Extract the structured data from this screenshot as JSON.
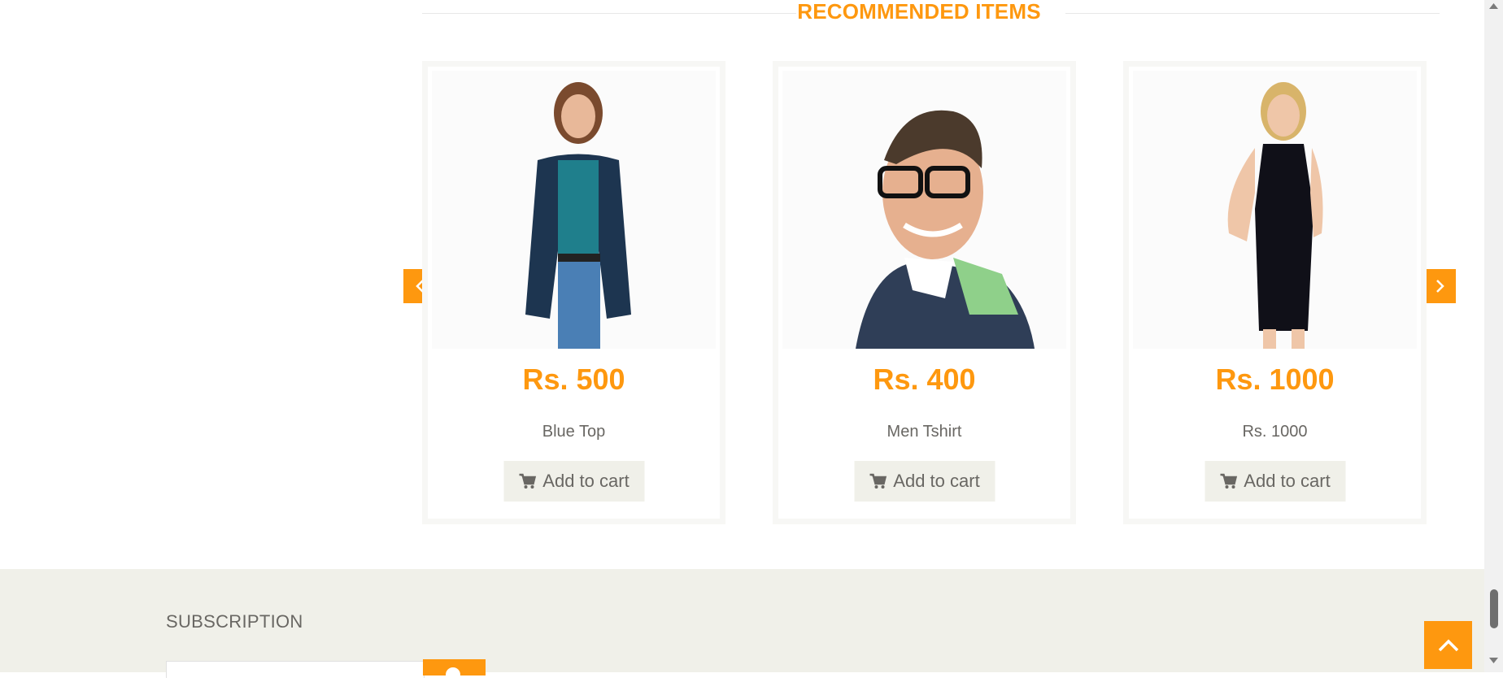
{
  "recommended": {
    "title": "RECOMMENDED ITEMS",
    "items": [
      {
        "price": "Rs. 500",
        "name": "Blue Top",
        "button": "Add to cart"
      },
      {
        "price": "Rs. 400",
        "name": "Men Tshirt",
        "button": "Add to cart"
      },
      {
        "price": "Rs. 1000",
        "name": "Rs. 1000",
        "button": "Add to cart"
      }
    ]
  },
  "footer": {
    "subscription_title": "SUBSCRIPTION"
  },
  "colors": {
    "accent": "#FE980F",
    "footer_bg": "#F0F0E9",
    "text": "#696763"
  },
  "icons": [
    "chevron-left-icon",
    "chevron-right-icon",
    "cart-icon",
    "chevron-up-icon"
  ]
}
